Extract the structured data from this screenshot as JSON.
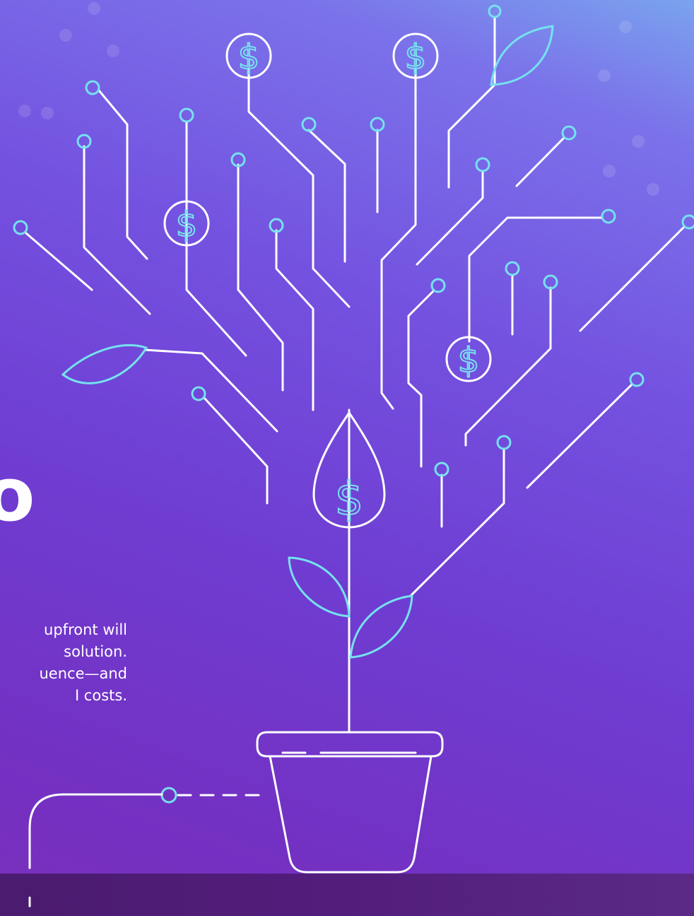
{
  "heading_fragment": "o",
  "body_text": {
    "line1": " upfront will",
    "line2": " solution.",
    "line3": "uence—and",
    "line4": "I costs."
  },
  "icons": {
    "coin_symbol": "$",
    "illustration": "money-tree-icon",
    "pot": "flower-pot-icon"
  },
  "colors": {
    "gradient_top": "#7aa3ee",
    "gradient_bottom": "#7a2fbc",
    "line": "#ffffff",
    "accent": "#76e1ef",
    "footer": "#4a1b6e"
  }
}
